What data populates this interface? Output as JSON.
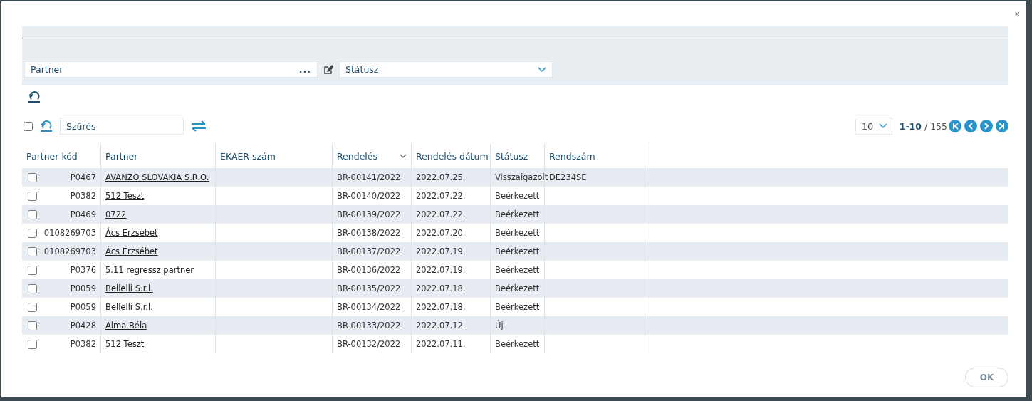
{
  "dialog": {
    "close": "×"
  },
  "filters": {
    "partner": {
      "placeholder": "Partner",
      "dots": "..."
    },
    "status": {
      "placeholder": "Státusz"
    }
  },
  "toolbar": {
    "select_all": {
      "checked": false
    },
    "search": {
      "placeholder": "Szűrés"
    }
  },
  "pager": {
    "page_size": "10",
    "range": "1-10",
    "total": "/ 155"
  },
  "table": {
    "columns": [
      {
        "label": "Partner kód",
        "sorted": false
      },
      {
        "label": "Partner",
        "sorted": false
      },
      {
        "label": "EKAER szám",
        "sorted": false
      },
      {
        "label": "Rendelés",
        "sorted": true
      },
      {
        "label": "Rendelés dátum",
        "sorted": false
      },
      {
        "label": "Státusz",
        "sorted": false
      },
      {
        "label": "Rendszám",
        "sorted": false
      }
    ],
    "rows": [
      {
        "checked": false,
        "code": "P0467",
        "partner": "AVANZO SLOVAKIA S.R.O.",
        "order": "BR-00141/2022",
        "date": "2022.07.25.",
        "status": "Visszaigazolt",
        "plate": "DE234SE"
      },
      {
        "checked": false,
        "code": "P0382",
        "partner": "512 Teszt",
        "order": "BR-00140/2022",
        "date": "2022.07.22.",
        "status": "Beérkezett"
      },
      {
        "checked": false,
        "code": "P0469",
        "partner": "0722",
        "order": "BR-00139/2022",
        "date": "2022.07.22.",
        "status": "Beérkezett"
      },
      {
        "checked": false,
        "code": "0108269703",
        "partner": "Ács Erzsébet",
        "order": "BR-00138/2022",
        "date": "2022.07.20.",
        "status": "Beérkezett"
      },
      {
        "checked": false,
        "code": "0108269703",
        "partner": "Ács Erzsébet",
        "order": "BR-00137/2022",
        "date": "2022.07.19.",
        "status": "Beérkezett"
      },
      {
        "checked": false,
        "code": "P0376",
        "partner": "5.11 regressz partner",
        "order": "BR-00136/2022",
        "date": "2022.07.19.",
        "status": "Beérkezett"
      },
      {
        "checked": false,
        "code": "P0059",
        "partner": "Bellelli S.r.l.",
        "order": "BR-00135/2022",
        "date": "2022.07.18.",
        "status": "Beérkezett"
      },
      {
        "checked": false,
        "code": "P0059",
        "partner": "Bellelli S.r.l.",
        "order": "BR-00134/2022",
        "date": "2022.07.18.",
        "status": "Beérkezett"
      },
      {
        "checked": false,
        "code": "P0428",
        "partner": "Alma Béla",
        "order": "BR-00133/2022",
        "date": "2022.07.12.",
        "status": "Új"
      },
      {
        "checked": false,
        "code": "P0382",
        "partner": "512 Teszt",
        "order": "BR-00132/2022",
        "date": "2022.07.11.",
        "status": "Beérkezett"
      }
    ]
  },
  "ok_button": {
    "label": "OK",
    "disabled": true
  }
}
